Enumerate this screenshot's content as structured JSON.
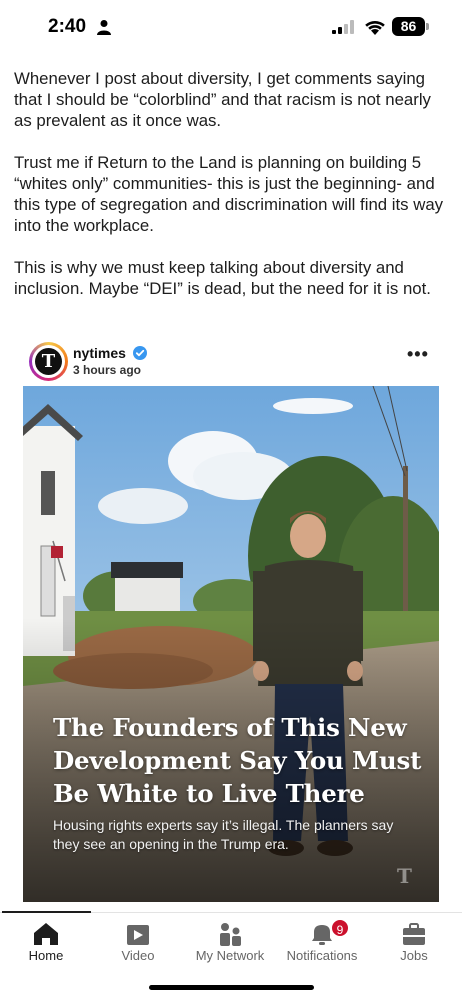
{
  "status_bar": {
    "time": "2:40",
    "battery": "86"
  },
  "post": {
    "paragraphs": [
      "Whenever I post about diversity, I get comments saying that I should be “colorblind” and that racism is not nearly as prevalent as it once was.",
      "Trust me if Return to the Land is planning on building 5 “whites only” communities- this is just the beginning- and this type of segregation and discrimination will find its way into the workplace.",
      "This is why we must keep talking about diversity and inclusion.  Maybe “DEI” is dead, but the need for it is not."
    ]
  },
  "embed": {
    "username": "nytimes",
    "timestamp": "3 hours ago",
    "more_icon": "more-horizontal-icon",
    "headline": "The Founders of This New Development Say You Must Be White to Live There",
    "subheadline": "Housing rights experts say it’s illegal. The planners say they see an opening in the Trump era.",
    "verified_color": "#3897f0"
  },
  "tabs": [
    {
      "label": "Home",
      "icon": "home-icon",
      "active": true
    },
    {
      "label": "Video",
      "icon": "video-icon",
      "active": false
    },
    {
      "label": "My Network",
      "icon": "network-icon",
      "active": false
    },
    {
      "label": "Notifications",
      "icon": "bell-icon",
      "active": false,
      "badge": "9"
    },
    {
      "label": "Jobs",
      "icon": "briefcase-icon",
      "active": false
    }
  ],
  "colors": {
    "badge": "#cb112d",
    "active_tab": "#1d1d1d",
    "inactive_tab": "#666666"
  }
}
